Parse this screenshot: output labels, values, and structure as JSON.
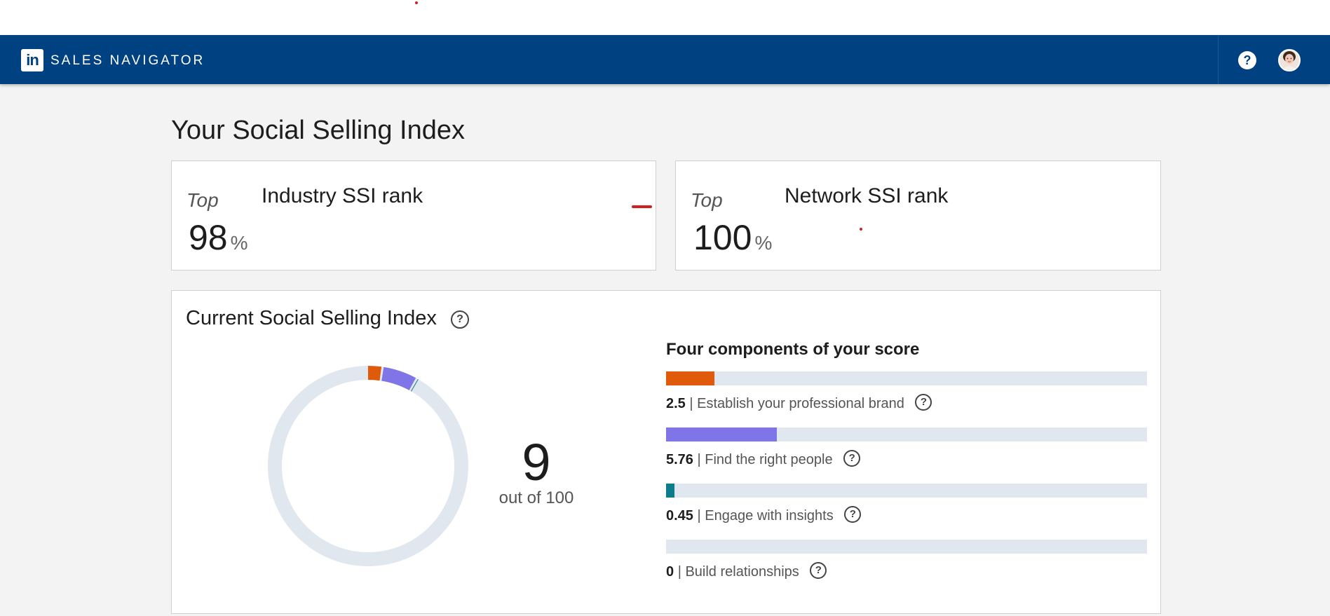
{
  "navbar": {
    "logo_text": "in",
    "brand": "SALES NAVIGATOR",
    "help_glyph": "?",
    "bg_color": "#004182"
  },
  "page": {
    "title": "Your Social Selling Index"
  },
  "industry_rank": {
    "top_label": "Top",
    "label": "Industry SSI rank",
    "value": "98",
    "unit": "%"
  },
  "network_rank": {
    "top_label": "Top",
    "label": "Network SSI rank",
    "value": "100",
    "unit": "%"
  },
  "ssi": {
    "title": "Current Social Selling Index",
    "score": "9",
    "score_sub": "out of 100",
    "components_title": "Four components of your score",
    "max_per_component": 25,
    "components": [
      {
        "value": "2.5",
        "separator": "|",
        "label": "Establish your professional brand",
        "color": "#e05a0c",
        "fraction": 0.1
      },
      {
        "value": "5.76",
        "separator": "|",
        "label": "Find the right people",
        "color": "#8075e6",
        "fraction": 0.2304
      },
      {
        "value": "0.45",
        "separator": "|",
        "label": "Engage with insights",
        "color": "#0d7c8c",
        "fraction": 0.018
      },
      {
        "value": "0",
        "separator": "|",
        "label": "Build relationships",
        "color": "#3a7d3a",
        "fraction": 0
      }
    ],
    "track_color": "#e1e7ee"
  },
  "icons": {
    "help": "question-circle-icon",
    "avatar": "user-avatar"
  }
}
